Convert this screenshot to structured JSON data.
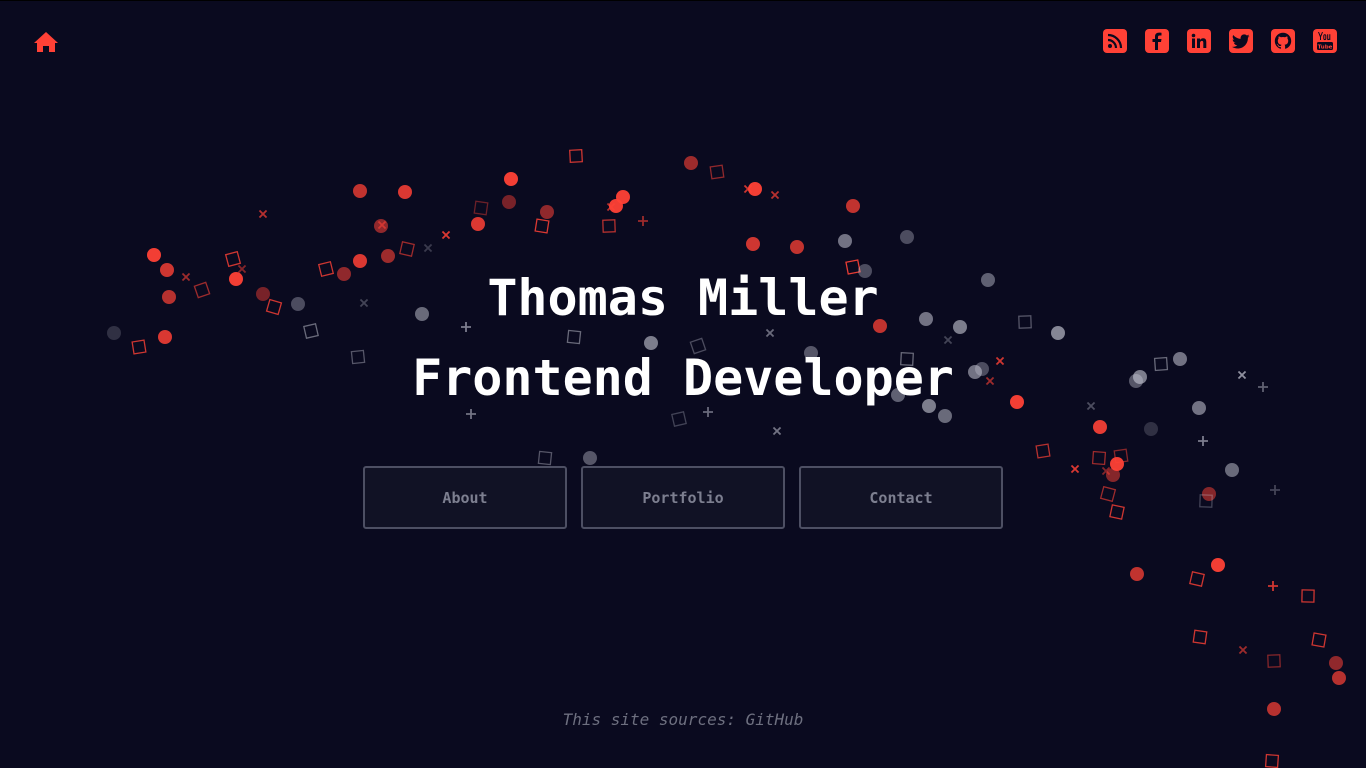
{
  "header": {
    "home_icon": "home-icon",
    "social": [
      {
        "name": "rss-icon"
      },
      {
        "name": "facebook-icon"
      },
      {
        "name": "linkedin-icon"
      },
      {
        "name": "twitter-icon"
      },
      {
        "name": "github-icon"
      },
      {
        "name": "youtube-icon"
      }
    ]
  },
  "hero": {
    "name_line": "Thomas Miller",
    "role_line": "Frontend Developer"
  },
  "nav": {
    "about_label": "About",
    "portfolio_label": "Portfolio",
    "contact_label": "Contact"
  },
  "footer": {
    "prefix": "This site sources: ",
    "link_label": "GitHub"
  },
  "colors": {
    "background": "#0a0a1f",
    "accent": "#ff4136",
    "text": "#ffffff",
    "muted": "#6d6f7f"
  }
}
